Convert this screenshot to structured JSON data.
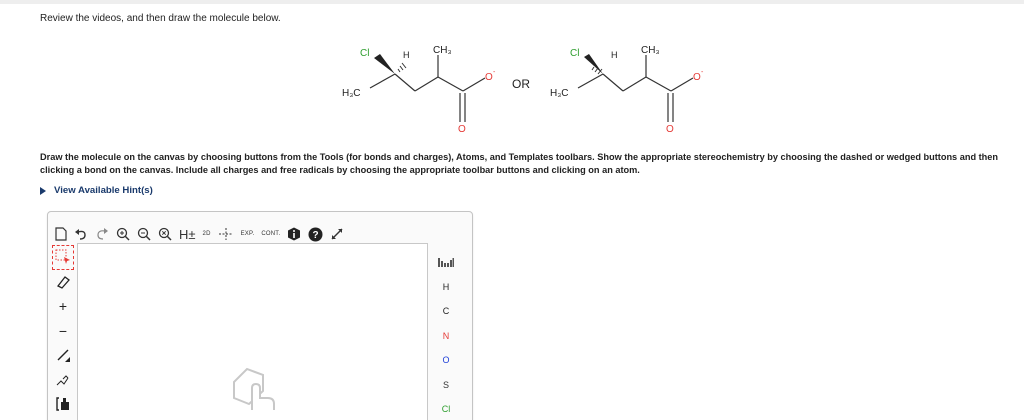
{
  "page": {
    "intro": "Review the videos, and then draw the molecule below.",
    "instructions": "Draw the molecule on the canvas by choosing buttons from the Tools (for bonds and charges), Atoms, and Templates toolbars. Show the appropriate stereochemistry by choosing the dashed or wedged buttons and then clicking a bond on the canvas. Include all charges and free radicals by choosing the appropriate toolbar buttons and clicking on an atom.",
    "hint": "View Available Hint(s)"
  },
  "molecule": {
    "left": {
      "cl": "Cl",
      "h": "H",
      "ch3": "CH₃",
      "h3c": "H₃C",
      "o_minus": "O",
      "o_double": "O"
    },
    "or": "OR",
    "right": {
      "cl": "Cl",
      "h": "H",
      "ch3": "CH₃",
      "h3c": "H₃C",
      "o_minus": "O",
      "o_double": "O"
    }
  },
  "toolbar": {
    "h_label": "H±",
    "two_d": "2D",
    "exp": "EXP.",
    "cont": "CONT."
  },
  "atoms": [
    "H",
    "C",
    "N",
    "O",
    "S",
    "Cl"
  ],
  "colors": {
    "cl": "#2e9e2e",
    "o": "#e53935",
    "n": "#1e3fd8",
    "hint": "#1a3a6c"
  }
}
